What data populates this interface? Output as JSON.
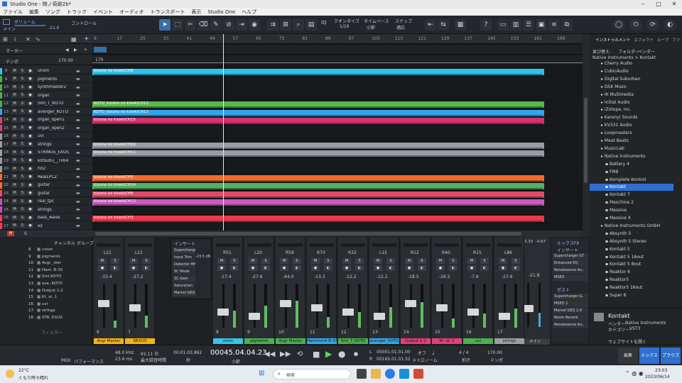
{
  "window": {
    "title": "Studio One - 時ノ奇跡2b*"
  },
  "menu": [
    "ファイル",
    "編集",
    "ソング",
    "トラック",
    "イベント",
    "オーディオ",
    "トランスポート",
    "表示",
    "Studio One",
    "ヘルプ"
  ],
  "toolbar": {
    "volume_label": "ボリューム",
    "volume_sub": "メイン",
    "volume_value": "-21.6",
    "control_label": "コントロール",
    "quantize_label": "クオンタイズ",
    "quantize_value": "1/16",
    "timebase_label": "タイムベース",
    "timebase_value": "小節",
    "snap_label": "スナップ",
    "snap_value": "適応"
  },
  "ruler": {
    "marks": [
      "9",
      "17",
      "25",
      "33",
      "41",
      "49",
      "57",
      "65",
      "73",
      "81",
      "89",
      "97",
      "105",
      "113",
      "121",
      "129",
      "137",
      "145",
      "153",
      "161",
      "169"
    ],
    "tempo_label": "テンポ",
    "marker_label": "マーカー",
    "tempo_value": "170.00",
    "tempo_lane_value": "170"
  },
  "tracks": [
    {
      "n": "8",
      "name": "union",
      "color": "#36c6e8"
    },
    {
      "n": "9",
      "name": "pigments",
      "color": "#4caf50"
    },
    {
      "n": "10",
      "name": "synthmaster2",
      "color": "#4caf50"
    },
    {
      "n": "11",
      "name": "organ",
      "color": "#4caf50"
    },
    {
      "n": "12",
      "name": "Sml_T_KOTO",
      "color": "#4caf50"
    },
    {
      "n": "13",
      "name": "avenger_KOTO",
      "color": "#36a8e8"
    },
    {
      "n": "14",
      "name": "organ_open1",
      "color": "#e0407a"
    },
    {
      "n": "15",
      "name": "organ_open2",
      "color": "#e0407a"
    },
    {
      "n": "16",
      "name": "uvi",
      "color": "#9e9e9e"
    },
    {
      "n": "17",
      "name": "strings",
      "color": "#9e9e9e"
    },
    {
      "n": "18",
      "name": "STRINGS_EXUS",
      "color": "#9e9e9e"
    },
    {
      "n": "19",
      "name": "kotsubu__Tx64",
      "color": "#9e9e9e"
    },
    {
      "n": "20",
      "name": "hit2",
      "color": "#9e9e9e"
    },
    {
      "n": "21",
      "name": "RealLPC2",
      "color": "#ff6a2a"
    },
    {
      "n": "22",
      "name": "guitar",
      "color": "#ff6a2a"
    },
    {
      "n": "23",
      "name": "guitar",
      "color": "#e64a6a"
    },
    {
      "n": "24",
      "name": "real_tpc",
      "color": "#c850c0"
    },
    {
      "n": "25",
      "name": "strings",
      "color": "#c850c0"
    },
    {
      "n": "26",
      "name": "bass_wave",
      "color": "#ff3a5a"
    },
    {
      "n": "27",
      "name": "ez",
      "color": "#ff3a5a"
    }
  ],
  "clips": [
    {
      "label": "kizuna no kisekiCH8",
      "row": 0,
      "color": "#2ec4ec"
    },
    {
      "label": "KOTO_kizuna no kisekiCH12",
      "row": 4,
      "color": "#58b848"
    },
    {
      "label": "KOTO_kizuna no kisekiCH12",
      "row": 5,
      "color": "#2fa6ee"
    },
    {
      "label": "kizuna no kisekiCH15",
      "row": 6,
      "color": "#d8306e"
    },
    {
      "label": "kizuna no kisekiCH16",
      "row": 9,
      "color": "#9a9ea4"
    },
    {
      "label": "kizuna no kisekiCH11",
      "row": 10,
      "color": "#9a9ea4"
    },
    {
      "label": "kizuna no kisekiCH5",
      "row": 13,
      "color": "#f46a30"
    },
    {
      "label": "kizuna no kisekiCH14",
      "row": 14,
      "color": "#56b060"
    },
    {
      "label": "kizuna no kisekiCH6",
      "row": 15,
      "color": "#e04a6a"
    },
    {
      "label": "kizuna no kisekiCH13",
      "row": 16,
      "color": "#c85ac0"
    },
    {
      "label": "kizuna no kisekiCH3",
      "row": 18,
      "color": "#f03848"
    }
  ],
  "browser": {
    "tabs": [
      "インストゥルメント",
      "エフェクト",
      "ループ",
      "ファ"
    ],
    "sort_label": "並び替え:",
    "folder_label": "フォルダー",
    "vendor_label": "ベンダー",
    "path": "Native Instruments > Kontakt",
    "items": [
      {
        "label": "Cherry Audio",
        "lvl": 0
      },
      {
        "label": "CubicAudio",
        "lvl": 0
      },
      {
        "label": "Digital Suburban",
        "lvl": 0
      },
      {
        "label": "DSK Music",
        "lvl": 0
      },
      {
        "label": "IK Multimedia",
        "lvl": 0
      },
      {
        "label": "Initial Audio",
        "lvl": 0
      },
      {
        "label": "iZotope, Inc.",
        "lvl": 0
      },
      {
        "label": "Karanyi Sounds",
        "lvl": 0
      },
      {
        "label": "KV331 Audio",
        "lvl": 0
      },
      {
        "label": "Loopmasters",
        "lvl": 0
      },
      {
        "label": "Meat Beats",
        "lvl": 0
      },
      {
        "label": "MusicLab",
        "lvl": 0
      },
      {
        "label": "Native Instruments",
        "lvl": 0
      },
      {
        "label": "Battery 4",
        "lvl": 1
      },
      {
        "label": "FM8",
        "lvl": 1
      },
      {
        "label": "Komplete Kontrol",
        "lvl": 1
      },
      {
        "label": "Kontakt",
        "lvl": 1,
        "sel": true
      },
      {
        "label": "Kontakt 7",
        "lvl": 1
      },
      {
        "label": "Maschine 2",
        "lvl": 1
      },
      {
        "label": "Massive",
        "lvl": 1
      },
      {
        "label": "Massive X",
        "lvl": 1
      },
      {
        "label": "Native Instruments GmbH",
        "lvl": 0
      },
      {
        "label": "Absynth 5",
        "lvl": 1
      },
      {
        "label": "Absynth 5 Stereo",
        "lvl": 1
      },
      {
        "label": "Kontakt 5",
        "lvl": 1
      },
      {
        "label": "Kontakt 5 16out",
        "lvl": 1
      },
      {
        "label": "Kontakt 5 8out",
        "lvl": 1
      },
      {
        "label": "Reaktor 6",
        "lvl": 1
      },
      {
        "label": "Reaktor5",
        "lvl": 1
      },
      {
        "label": "Reaktor5 16out",
        "lvl": 1
      },
      {
        "label": "Super 8",
        "lvl": 1
      }
    ],
    "info_name": "Kontakt",
    "info_vendor_label": "ベンダー:",
    "info_vendor": "Native Instruments",
    "info_cat_label": "カテゴリー:",
    "info_cat": "VST3",
    "info_hint": "ウェブサイトを開く"
  },
  "mixer": {
    "list_header_channel": "チャンネル",
    "list_header_group": "グループ",
    "list": [
      {
        "n": "8",
        "name": "union"
      },
      {
        "n": "9",
        "name": "pigments"
      },
      {
        "n": "10",
        "name": "Avgr._ster"
      },
      {
        "n": "11",
        "name": "Ham. B-3X"
      },
      {
        "n": "12",
        "name": "Sml.KOTO"
      },
      {
        "n": "13",
        "name": "ave..KOTO"
      },
      {
        "n": "14",
        "name": "Output 1-2"
      },
      {
        "n": "15",
        "name": "Kt. st. 1"
      },
      {
        "n": "16",
        "name": "uvi"
      },
      {
        "n": "17",
        "name": "strings"
      },
      {
        "n": "18",
        "name": "STR..EXUS"
      }
    ],
    "filter_label": "フィルター",
    "inserts_title": "インサート",
    "inserts": [
      "Supercharger GT",
      "Input Trim",
      "Detector HP",
      "SC Mode",
      "SC Gain",
      "Saturation",
      "Marvel GEQ 2.9"
    ],
    "input_trim_value": "-23.5 dB",
    "strips": [
      {
        "pan": "L21",
        "db": "-33.4",
        "ch": "6",
        "label": "Avgr Master",
        "color": "#f3b21a"
      },
      {
        "pan": "L21",
        "db": "-27.2",
        "ch": "7",
        "label": "NEXUS",
        "color": "#f3b21a"
      },
      {
        "pan": "R51",
        "db": "-17.4",
        "ch": "8",
        "label": "union",
        "color": "#36c6e8"
      },
      {
        "pan": "L20",
        "db": "-27.6",
        "ch": "9",
        "label": "pigments",
        "color": "#4caf50"
      },
      {
        "pan": "R59",
        "db": "-44.0",
        "ch": "10",
        "label": "Avgr Master",
        "color": "#4caf50"
      },
      {
        "pan": "R70",
        "db": "-13.3",
        "ch": "11",
        "label": "Hammond B-3X",
        "color": "#36a8e8"
      },
      {
        "pan": "R32",
        "db": "-12.2",
        "ch": "12",
        "label": "Sml_T_KOTO",
        "color": "#4caf50"
      },
      {
        "pan": "L15",
        "db": "-12.2",
        "ch": "13",
        "label": "avenger_KOTO",
        "color": "#36a8e8"
      },
      {
        "pan": "R12",
        "db": "-18.5",
        "ch": "14",
        "label": "Output 1-2",
        "color": "#e0407a"
      },
      {
        "pan": "R40",
        "db": "-26.5",
        "ch": "15",
        "label": "Kt. st. 1",
        "color": "#e0407a"
      },
      {
        "pan": "R15",
        "db": "-7.9",
        "ch": "16",
        "label": "uvi",
        "color": "#4caf50"
      },
      {
        "pan": "L86",
        "db": "-27.6",
        "ch": "17",
        "label": "strings",
        "color": "#9e9e9e"
      }
    ],
    "main_label": "メイン",
    "main_db": "-21.8",
    "main_peak": "-3.33",
    "main_rms": "-4.67",
    "fx_title": "ミックスFX",
    "fx_insert_title": "インサート",
    "fx_inserts": [
      "Supercharger GT",
      "Enhanced EQ",
      "Renaissance Ax..",
      "MSED"
    ],
    "post_title": "ポスト",
    "post_inserts": [
      "Supercharger G..",
      "MSED 2",
      "Marvel GEQ 2.9",
      "Room Reverb",
      "Renaissance Ax.."
    ]
  },
  "transport": {
    "midi_label": "MIDI",
    "perf_label": "パフォーマンス",
    "sample_rate": "48.0 kHz",
    "latency": "23.4 ms",
    "time_remaining": "91:11 日",
    "remaining_label": "最大録音時間",
    "seconds": "00:01:03.862",
    "seconds_label": "秒",
    "position": "00045.04.04.23",
    "position_label": "小節",
    "loop_l": "00001.01.01.00",
    "loop_r": "00165.01.01.52",
    "off_label": "オフ",
    "metronome_label": "メトロノーム",
    "sig": "4 / 4",
    "sig_label": "拍子",
    "tempo": "170.00",
    "tempo_label": "テンポ",
    "tab_edit": "編集",
    "tab_mix": "ミックス",
    "tab_browse": "ブラウズ"
  },
  "taskbar": {
    "weather_temp": "22°C",
    "weather_desc": "くもり時々晴れ",
    "search_placeholder": "検索",
    "time": "23:03",
    "date": "2023/06/14"
  }
}
